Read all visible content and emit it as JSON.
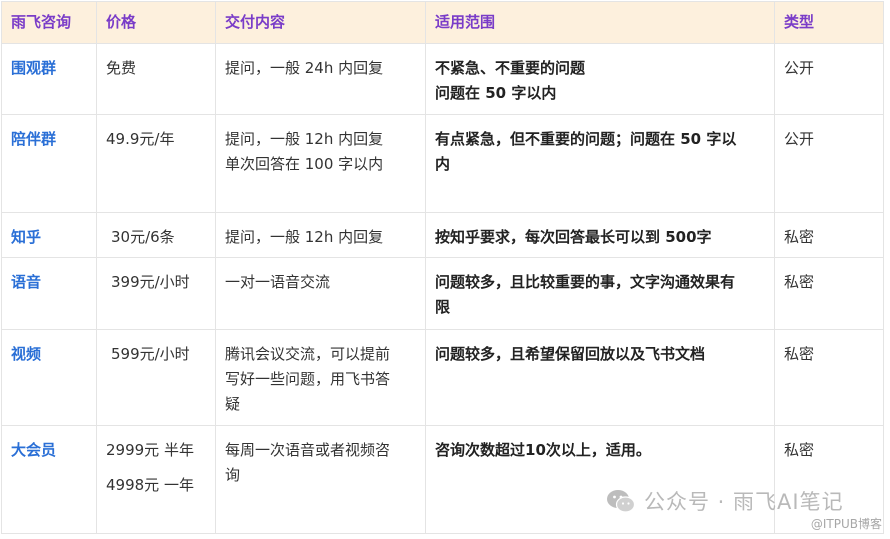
{
  "headers": [
    "雨飞咨询",
    "价格",
    "交付内容",
    "适用范围",
    "类型"
  ],
  "rows": [
    {
      "name": "围观群",
      "price": [
        "免费"
      ],
      "delivery": [
        "提问，一般 24h 内回复"
      ],
      "scope": [
        "不紧急、不重要的问题",
        "问题在 50 字以内"
      ],
      "type": "公开"
    },
    {
      "name": "陪伴群",
      "price": [
        "49.9元/年"
      ],
      "delivery": [
        "提问，一般 12h 内回复",
        "单次回答在 100 字以内"
      ],
      "scope": [
        "有点紧急，但不重要的问题；问题在 50 字以",
        "内"
      ],
      "type": "公开"
    },
    {
      "name": "知乎",
      "price": [
        "30元/6条"
      ],
      "delivery": [
        "提问，一般 12h 内回复"
      ],
      "scope": [
        "按知乎要求，每次回答最长可以到 500字"
      ],
      "type": "私密"
    },
    {
      "name": "语音",
      "price": [
        "399元/小时"
      ],
      "delivery": [
        "一对一语音交流"
      ],
      "scope": [
        "问题较多，且比较重要的事，文字沟通效果有",
        "限"
      ],
      "type": "私密"
    },
    {
      "name": "视频",
      "price": [
        "599元/小时"
      ],
      "delivery": [
        "腾讯会议交流，可以提前",
        "写好一些问题，用飞书答",
        "疑"
      ],
      "scope": [
        "问题较多，且希望保留回放以及飞书文档"
      ],
      "type": "私密"
    },
    {
      "name": "大会员",
      "price": [
        "2999元 半年",
        "4998元 一年"
      ],
      "delivery": [
        "每周一次语音或者视频咨",
        "询"
      ],
      "scope": [
        "咨询次数超过10次以上，适用。"
      ],
      "type": "私密"
    }
  ],
  "watermark": {
    "text": "公众号 · 雨飞AI笔记",
    "icon": "wechat-icon",
    "sub": "@ITPUB博客"
  }
}
